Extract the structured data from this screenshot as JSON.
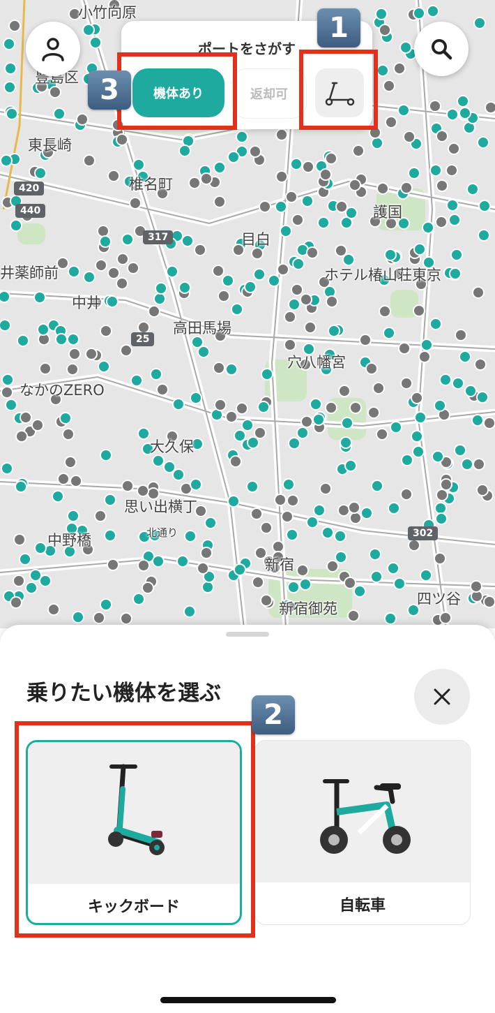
{
  "map": {
    "labels": [
      {
        "name": "label-kotake-mukaihara",
        "text": "小竹向原"
      },
      {
        "name": "label-toshima-ku",
        "text": "豊島区"
      },
      {
        "name": "label-higashi-nagasaki",
        "text": "東長崎"
      },
      {
        "name": "label-shiinamachi",
        "text": "椎名町"
      },
      {
        "name": "label-mejiro",
        "text": "目白"
      },
      {
        "name": "label-gokoku",
        "text": "護国"
      },
      {
        "name": "label-arai-yakushimae",
        "text": "井薬師前"
      },
      {
        "name": "label-hotel",
        "text": "ホテル椿山荘東京"
      },
      {
        "name": "label-nakai",
        "text": "中井"
      },
      {
        "name": "label-takadanobaba",
        "text": "高田馬場"
      },
      {
        "name": "label-anahachiman",
        "text": "穴八幡宮"
      },
      {
        "name": "label-nakano-zero",
        "text": "なかのZERO"
      },
      {
        "name": "label-okubo",
        "text": "大久保"
      },
      {
        "name": "label-omoide-yokocho",
        "text": "思い出横丁"
      },
      {
        "name": "label-kitadori",
        "text": "北通り"
      },
      {
        "name": "label-nakano-bridge",
        "text": "中野橋"
      },
      {
        "name": "label-shinjuku",
        "text": "新宿"
      },
      {
        "name": "label-shinjuku-gyoen",
        "text": "新宿御苑"
      },
      {
        "name": "label-yotsuya",
        "text": "四ツ谷"
      }
    ],
    "routes": [
      {
        "name": "route-420",
        "text": "420"
      },
      {
        "name": "route-440",
        "text": "440"
      },
      {
        "name": "route-317",
        "text": "317"
      },
      {
        "name": "route-25",
        "text": "25"
      },
      {
        "name": "route-302",
        "text": "302"
      }
    ]
  },
  "filter": {
    "title": "ポートをさがす",
    "chip_available": "機体あり",
    "chip_return": "返却可"
  },
  "annotations": {
    "badge1": "1",
    "badge2": "2",
    "badge3": "3"
  },
  "sheet": {
    "title": "乗りたい機体を選ぶ",
    "options": [
      {
        "label": "キックボード"
      },
      {
        "label": "自転車"
      }
    ]
  },
  "colors": {
    "accent": "#1faaa0",
    "highlight": "#e0311b",
    "port_empty": "#777777"
  }
}
